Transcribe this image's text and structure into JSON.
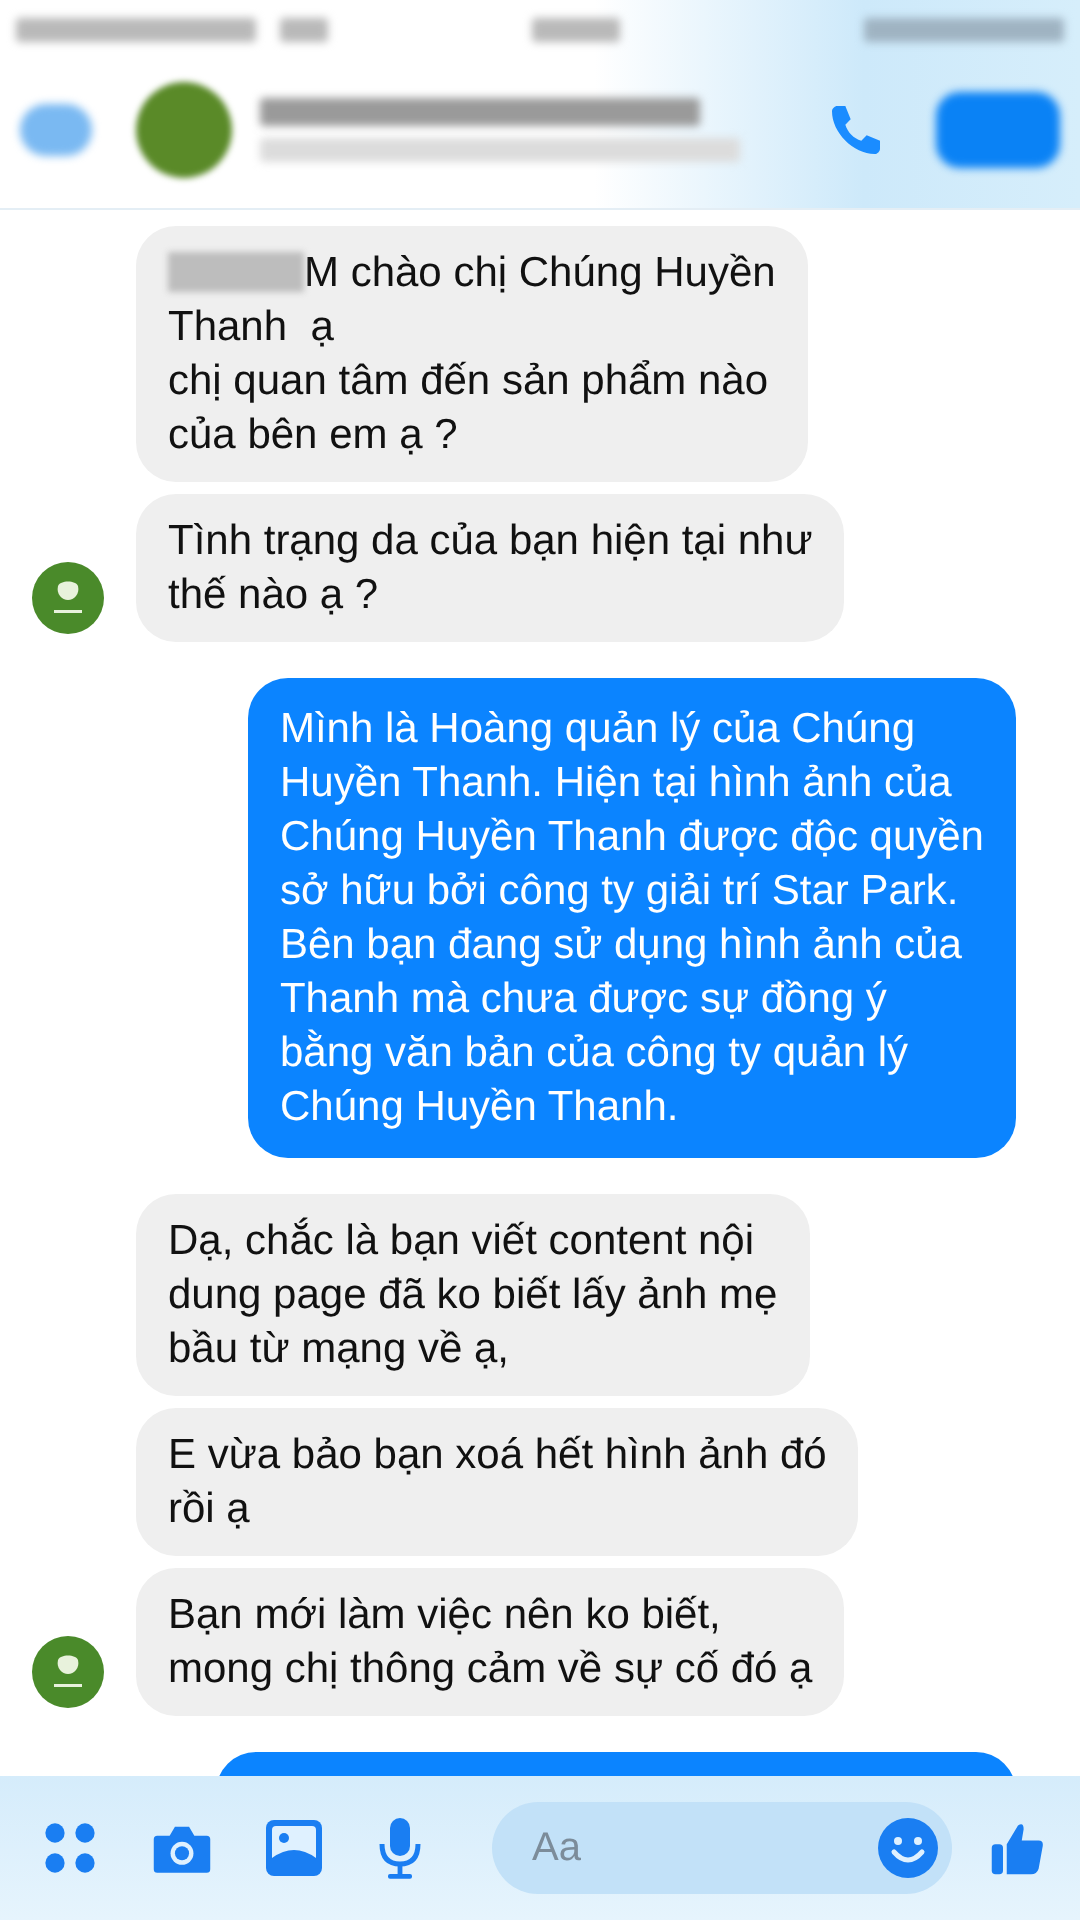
{
  "messages": [
    {
      "kind": "received",
      "avatar": false,
      "redacted_prefix": true,
      "text": "M chào chị Chúng Huyền\nThanh  ạ\nchị quan tâm đến sản phẩm nào\ncủa bên em ạ ?"
    },
    {
      "kind": "received",
      "avatar": true,
      "redacted_prefix": false,
      "text": "Tình trạng da của bạn hiện tại như\nthế nào ạ ?"
    },
    {
      "kind": "sent",
      "avatar": false,
      "redacted_prefix": false,
      "text": "Mình là Hoàng quản lý của Chúng\nHuyền Thanh. Hiện tại hình ảnh của\nChúng Huyền Thanh được độc quyền\nsở hữu bởi công ty giải trí Star Park.\nBên bạn đang sử dụng hình ảnh của\nThanh mà chưa được sự đồng ý\nbằng văn bản của công ty quản lý\nChúng Huyền Thanh."
    },
    {
      "kind": "received",
      "avatar": false,
      "redacted_prefix": false,
      "text": "Dạ, chắc là bạn viết content nội\ndung page đã ko biết lấy ảnh mẹ\nbầu từ mạng về ạ,"
    },
    {
      "kind": "received",
      "avatar": false,
      "redacted_prefix": false,
      "text": "E vừa bảo bạn xoá hết hình ảnh đó\nrồi ạ"
    },
    {
      "kind": "received",
      "avatar": true,
      "redacted_prefix": false,
      "text": "Bạn mới làm việc nên ko biết,\nmong chị thông cảm về sự cố đó ạ"
    },
    {
      "kind": "partial"
    }
  ],
  "composer": {
    "placeholder": "Aa"
  }
}
